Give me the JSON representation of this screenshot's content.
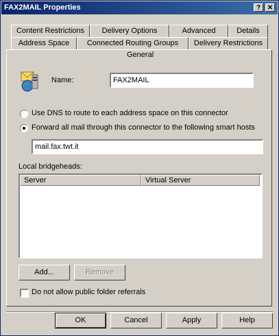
{
  "window": {
    "title": "FAX2MAIL Properties",
    "help_glyph": "?",
    "close_glyph": "✕"
  },
  "tabs": {
    "row1": [
      "Content Restrictions",
      "Delivery Options",
      "Advanced",
      "Details"
    ],
    "row2": [
      "Address Space",
      "Connected Routing Groups",
      "Delivery Restrictions"
    ],
    "active": "General"
  },
  "general": {
    "name_label": "Name:",
    "name_value": "FAX2MAIL",
    "radio_dns_label": "Use DNS to route to each address space on this connector",
    "radio_forward_label": "Forward all mail through this connector to the following smart hosts",
    "selected_option": "forward",
    "smart_host_value": "mail.fax.twt.it",
    "bridgeheads_label": "Local bridgeheads:",
    "columns": [
      "Server",
      "Virtual Server"
    ],
    "add_button": "Add...",
    "remove_button": "Remove",
    "public_folder_label": "Do not allow public folder referrals",
    "public_folder_checked": false
  },
  "footer": {
    "ok": "OK",
    "cancel": "Cancel",
    "apply": "Apply",
    "help": "Help"
  },
  "icons": {
    "connector": "connector-mail-globe-icon"
  }
}
